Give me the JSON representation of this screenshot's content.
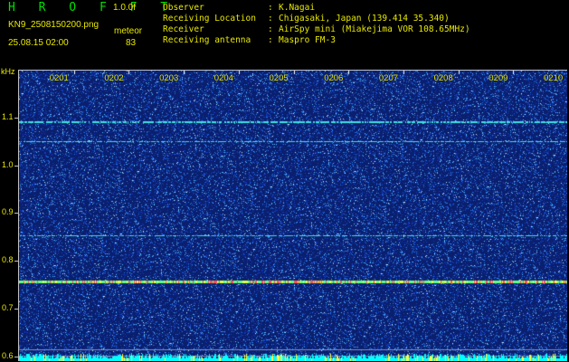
{
  "header": {
    "app_title": "H R O F F T",
    "version": "1.0.0f",
    "filename": "KN9_2508150200.png",
    "count_label": "meteor",
    "datetime": "25.08.15 02:00",
    "count": "83"
  },
  "station_info": [
    {
      "key": "Observer",
      "sep": ":",
      "value": "K.Nagai"
    },
    {
      "key": "Receiving Location",
      "sep": ":",
      "value": "Chigasaki, Japan (139.414 35.340)"
    },
    {
      "key": "Receiver",
      "sep": ":",
      "value": "AirSpy mini (Miakejima VOR 108.65MHz)"
    },
    {
      "key": "Receiving antenna",
      "sep": ":",
      "value": "Maspro FM-3"
    }
  ],
  "chart_data": {
    "type": "heatmap",
    "ylabel": "kHz",
    "ylim": [
      0.59,
      1.2
    ],
    "y_ticks": [
      "1.1",
      "1.0",
      "0.9",
      "0.8",
      "0.7",
      "0.6"
    ],
    "x_tick_labels": [
      "0201",
      "0202",
      "0203",
      "0204",
      "0205",
      "0206",
      "0207",
      "0208",
      "0209",
      "0210"
    ],
    "xlim_minutes": [
      0,
      10
    ],
    "horizontal_lines_khz": [
      1.093,
      1.052,
      0.855,
      0.758,
      0.617,
      0.603
    ],
    "colors": {
      "background": "#0a1f6e",
      "noise": "#3fa0ff",
      "line_cyan": "#40e0e0",
      "line_strong": "#60ff80",
      "base_band": "#00ffff"
    }
  }
}
